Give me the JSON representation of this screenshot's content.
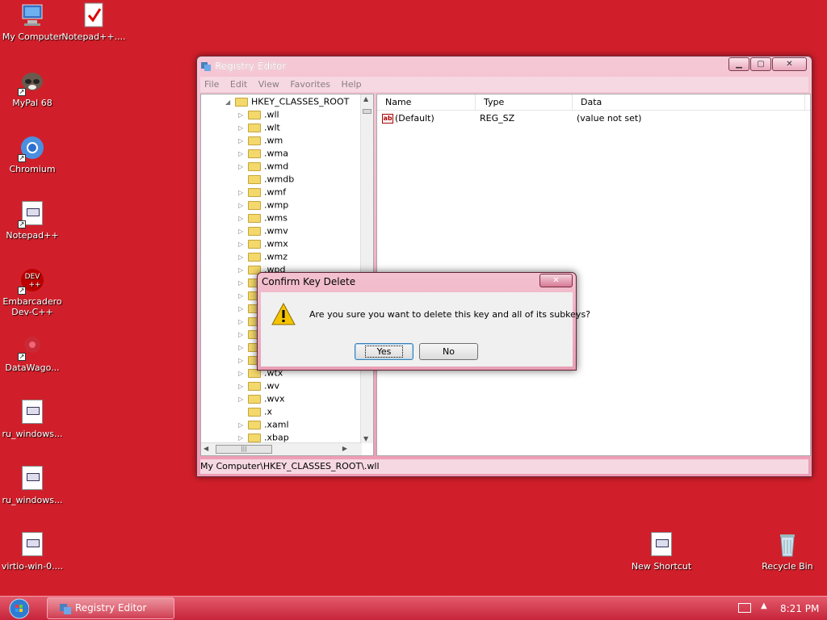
{
  "desktop": {
    "icons": [
      {
        "label": "My Computer",
        "icon": "computer-icon"
      },
      {
        "label": "Notepad++....",
        "icon": "notepad-doc-icon"
      },
      {
        "label": "MyPal 68",
        "icon": "raccoon-browser-icon"
      },
      {
        "label": "Chromium",
        "icon": "chromium-icon"
      },
      {
        "label": "Notepad++",
        "icon": "notepad-doc-icon"
      },
      {
        "label": "Embarcadero Dev-C++",
        "icon": "devcpp-icon"
      },
      {
        "label": "DataWago...",
        "icon": "datawagon-icon"
      },
      {
        "label": "ru_windows...",
        "icon": "document-icon"
      },
      {
        "label": "ru_windows...",
        "icon": "document-icon"
      },
      {
        "label": "virtio-win-0....",
        "icon": "document-icon"
      },
      {
        "label": "New Shortcut",
        "icon": "document-icon"
      },
      {
        "label": "Recycle Bin",
        "icon": "recycle-bin-icon"
      }
    ]
  },
  "window": {
    "title": "Registry Editor",
    "menu": [
      "File",
      "Edit",
      "View",
      "Favorites",
      "Help"
    ],
    "tree": {
      "root": "HKEY_CLASSES_ROOT",
      "items": [
        ".wll",
        ".wlt",
        ".wm",
        ".wma",
        ".wmd",
        ".wmdb",
        ".wmf",
        ".wmp",
        ".wms",
        ".wmv",
        ".wmx",
        ".wmz",
        ".wpd",
        "",
        "",
        "",
        "",
        "",
        "",
        "",
        ".wtx",
        ".wv",
        ".wvx",
        ".x",
        ".xaml",
        ".xbap"
      ]
    },
    "list": {
      "columns": [
        "Name",
        "Type",
        "Data"
      ],
      "rows": [
        {
          "name": "(Default)",
          "type": "REG_SZ",
          "data": "(value not set)"
        }
      ]
    },
    "status_path": "My Computer\\HKEY_CLASSES_ROOT\\.wll"
  },
  "dialog": {
    "title": "Confirm Key Delete",
    "message": "Are you sure you want to delete this key and all of its subkeys?",
    "yes_label": "Yes",
    "no_label": "No"
  },
  "taskbar": {
    "task_label": "Registry Editor",
    "clock": "8:21 PM"
  },
  "colors": {
    "desktop_bg": "#d01f2a",
    "window_frame": "#ee9cb5",
    "taskbar": "#c7243a"
  }
}
